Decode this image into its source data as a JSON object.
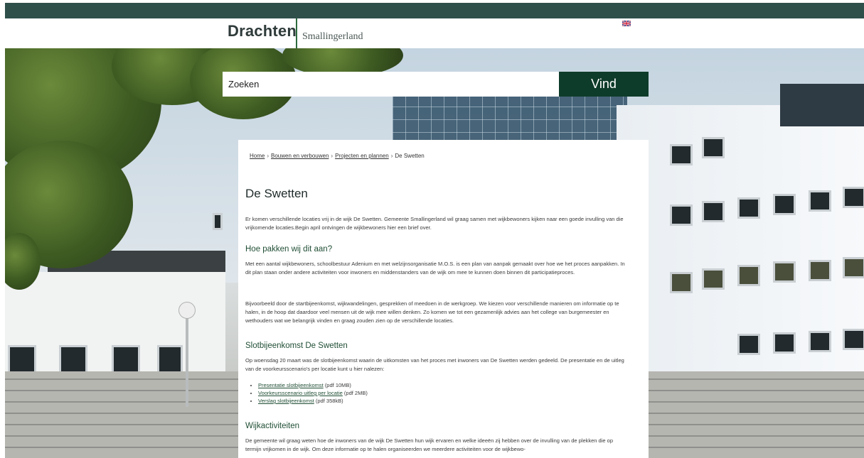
{
  "header": {
    "logo_main": "Drachten",
    "logo_sub": "Smallingerland",
    "flag_icon": "english-flag-icon"
  },
  "search": {
    "placeholder": "Zoeken",
    "button_label": "Vind"
  },
  "breadcrumb": {
    "items": [
      "Home",
      "Bouwen en verbouwen",
      "Projecten en plannen"
    ],
    "current": "De Swetten",
    "separator": "›"
  },
  "page": {
    "title": "De Swetten",
    "intro": "Er komen verschillende locaties vrij in de wijk De Swetten. Gemeente Smallingerland wil graag samen met wijkbewoners kijken naar een goede invulling van die vrijkomende locaties.Begin april ontvingen de wijkbewoners hier een brief over.",
    "section1": {
      "heading": "Hoe pakken wij dit aan?",
      "p1": "Met een aantal wijkbewoners, schoolbestuur Adenium en met welzijnsorganisatie M.O.S. is een plan van aanpak gemaakt over hoe we het proces aanpakken. In dit plan staan onder andere activiteiten voor inwoners en middenstanders van de wijk om mee te kunnen doen binnen dit participatieproces.",
      "p2": "Bijvoorbeeld door de startbijeenkomst, wijkwandelingen, gesprekken of meedoen in de werkgroep. We kiezen voor verschillende manieren om informatie op te halen, in de hoop dat daardoor veel mensen uit de wijk mee willen denken. Zo komen we tot een gezamenlijk advies aan het college van burgemeester en wethouders wat we belangrijk vinden en graag zouden zien op de verschillende locaties."
    },
    "section2": {
      "heading": "Slotbijeenkomst De Swetten",
      "p1": "Op woensdag 20 maart was de slotbijeenkomst waarin de uitkomsten van het proces met inwoners van De Swetten werden gedeeld. De presentatie en de uitleg van de voorkeursscenario's per locatie kunt u hier nalezen:",
      "links": [
        {
          "label": "Presentatie slotbijeenkomst",
          "meta": "(pdf 10MB)"
        },
        {
          "label": "Voorkeursscenario uitleg per locatie",
          "meta": "(pdf 2MB)"
        },
        {
          "label": "Verslag slotbijeenkomst",
          "meta": "(pdf 358kB)"
        }
      ]
    },
    "section3": {
      "heading": "Wijkactiviteiten",
      "p1": "De gemeente wil graag weten hoe de inwoners van de wijk De Swetten hun wijk ervaren en welke ideeën zij hebben over de invulling van de plekken die op termijn vrijkomen in de wijk. Om deze informatie op te halen organiseerden we meerdere activiteiten voor de wijkbewo-"
    }
  },
  "colors": {
    "topbar": "#2f4f4a",
    "search_button": "#0e3c2a",
    "heading_green": "#214f36"
  }
}
